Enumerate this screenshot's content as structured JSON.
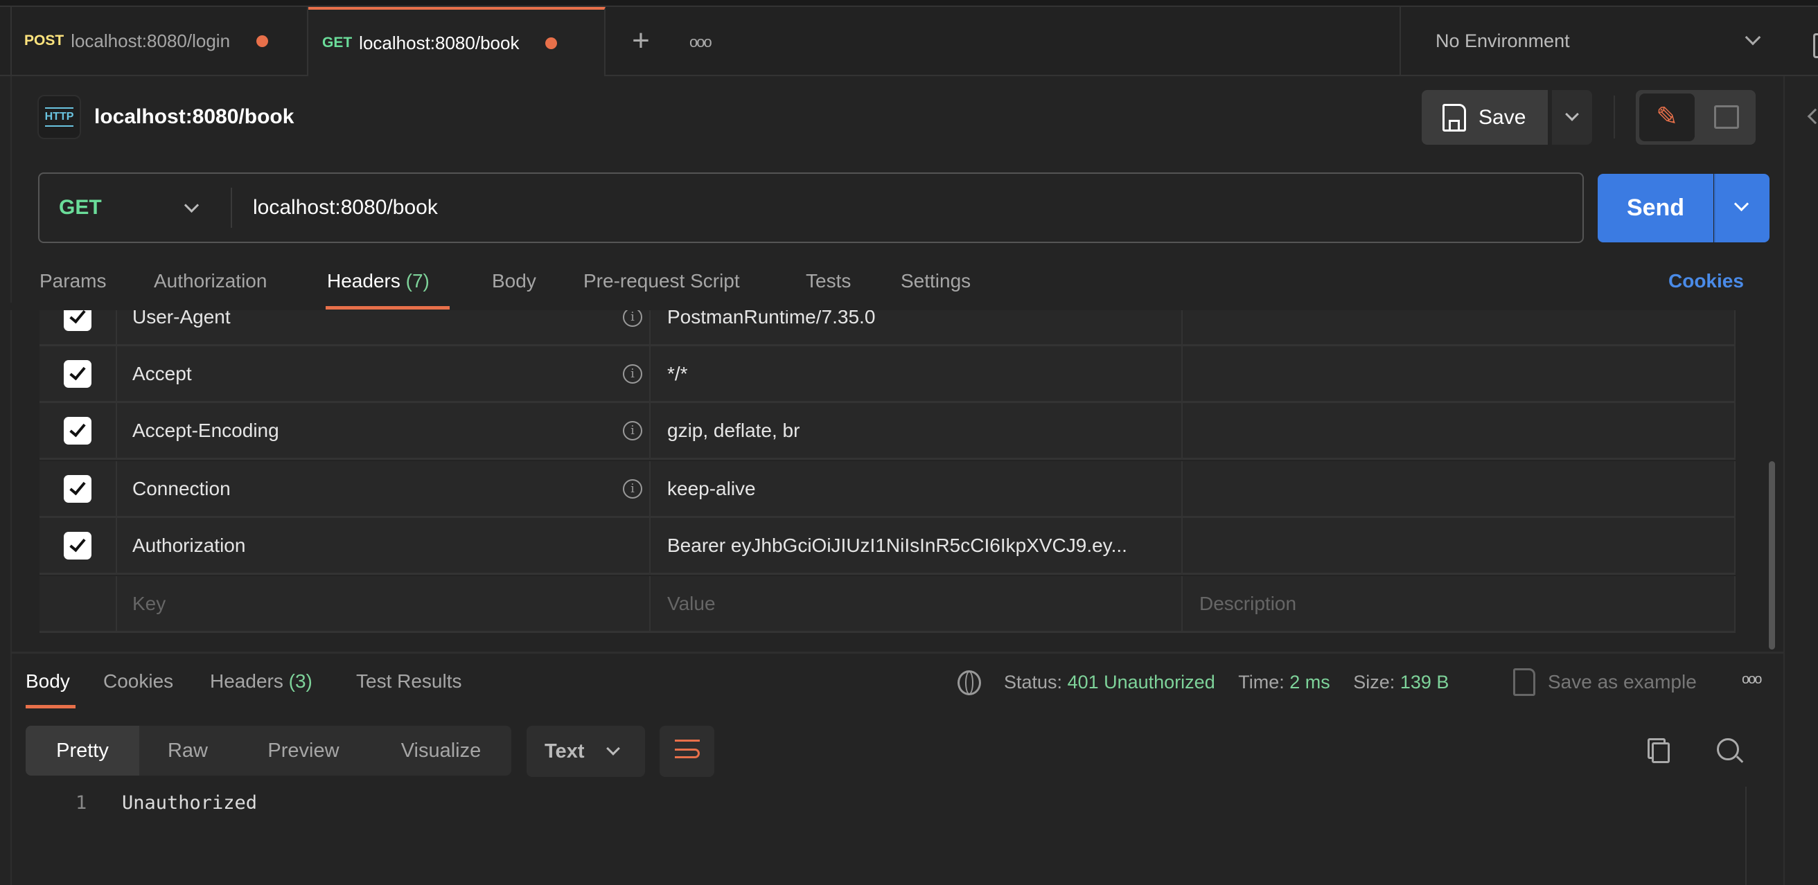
{
  "tabs": [
    {
      "method": "POST",
      "url": "localhost:8080/login",
      "unsaved": true,
      "active": false
    },
    {
      "method": "GET",
      "url": "localhost:8080/book",
      "unsaved": true,
      "active": true
    }
  ],
  "environment": {
    "selected": "No Environment"
  },
  "request": {
    "icon_label": "HTTP",
    "title": "localhost:8080/book",
    "save_label": "Save",
    "method": "GET",
    "url": "localhost:8080/book",
    "send_label": "Send"
  },
  "request_tabs": {
    "params": "Params",
    "authorization": "Authorization",
    "headers": "Headers",
    "headers_count": "(7)",
    "body": "Body",
    "prerequest": "Pre-request Script",
    "tests": "Tests",
    "settings": "Settings",
    "cookies": "Cookies",
    "active": "Headers"
  },
  "headers": [
    {
      "key": "User-Agent",
      "value": "PostmanRuntime/7.35.0",
      "checked": true,
      "info": true
    },
    {
      "key": "Accept",
      "value": "*/*",
      "checked": true,
      "info": true
    },
    {
      "key": "Accept-Encoding",
      "value": "gzip, deflate, br",
      "checked": true,
      "info": true
    },
    {
      "key": "Connection",
      "value": "keep-alive",
      "checked": true,
      "info": true
    },
    {
      "key": "Authorization",
      "value": "Bearer eyJhbGciOiJIUzI1NiIsInR5cCI6IkpXVCJ9.ey...",
      "checked": true,
      "info": false
    }
  ],
  "new_header": {
    "key_placeholder": "Key",
    "value_placeholder": "Value",
    "description_placeholder": "Description"
  },
  "response": {
    "tabs": {
      "body": "Body",
      "cookies": "Cookies",
      "headers": "Headers",
      "headers_count": "(3)",
      "test_results": "Test Results",
      "active": "Body"
    },
    "status_label": "Status:",
    "status": "401 Unauthorized",
    "time_label": "Time:",
    "time": "2 ms",
    "size_label": "Size:",
    "size": "139 B",
    "save_example": "Save as example",
    "formats": {
      "pretty": "Pretty",
      "raw": "Raw",
      "preview": "Preview",
      "visualize": "Visualize",
      "active": "Pretty"
    },
    "type": "Text",
    "lines": [
      {
        "n": "1",
        "text": "Unauthorized"
      }
    ]
  },
  "colors": {
    "accent": "#e8704a",
    "get": "#6bdd9a",
    "post": "#ffe47e",
    "send": "#3b7be2",
    "cookies": "#4a8be8",
    "status_ok": "#7ed39a"
  }
}
